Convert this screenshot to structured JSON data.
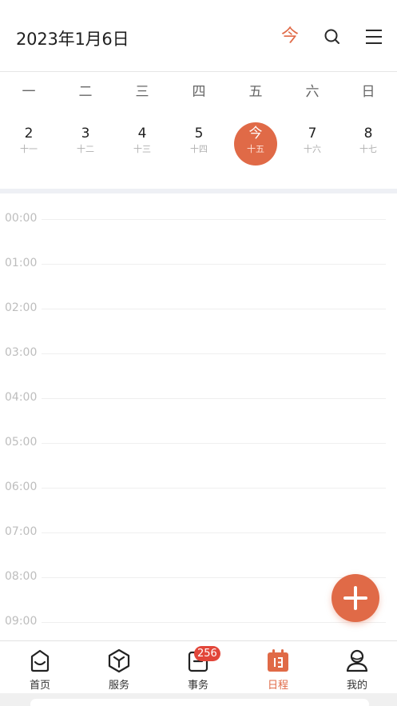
{
  "header": {
    "title": "2023年1月6日",
    "today_label": "今",
    "search_icon": "search-icon",
    "menu_icon": "menu-icon"
  },
  "week": {
    "weekdays": [
      "一",
      "二",
      "三",
      "四",
      "五",
      "六",
      "日"
    ],
    "days": [
      {
        "num": "2",
        "lunar": "十一"
      },
      {
        "num": "3",
        "lunar": "十二"
      },
      {
        "num": "4",
        "lunar": "十三"
      },
      {
        "num": "5",
        "lunar": "十四"
      },
      {
        "num": "今",
        "lunar": "十五"
      },
      {
        "num": "7",
        "lunar": "十六"
      },
      {
        "num": "8",
        "lunar": "十七"
      }
    ],
    "selected_index": 4
  },
  "timeline": {
    "hours": [
      "00:00",
      "01:00",
      "02:00",
      "03:00",
      "04:00",
      "05:00",
      "06:00",
      "07:00",
      "08:00",
      "09:00"
    ]
  },
  "fab": {
    "icon": "plus-icon"
  },
  "tabbar": {
    "items": [
      {
        "label": "首页",
        "icon": "home-icon"
      },
      {
        "label": "服务",
        "icon": "cube-icon"
      },
      {
        "label": "事务",
        "icon": "task-icon",
        "badge": "256"
      },
      {
        "label": "日程",
        "icon": "calendar-icon"
      },
      {
        "label": "我的",
        "icon": "user-icon"
      }
    ],
    "active_index": 3
  },
  "colors": {
    "accent": "#e06a47",
    "badge": "#e2463a",
    "separator": "#eef0f5"
  }
}
